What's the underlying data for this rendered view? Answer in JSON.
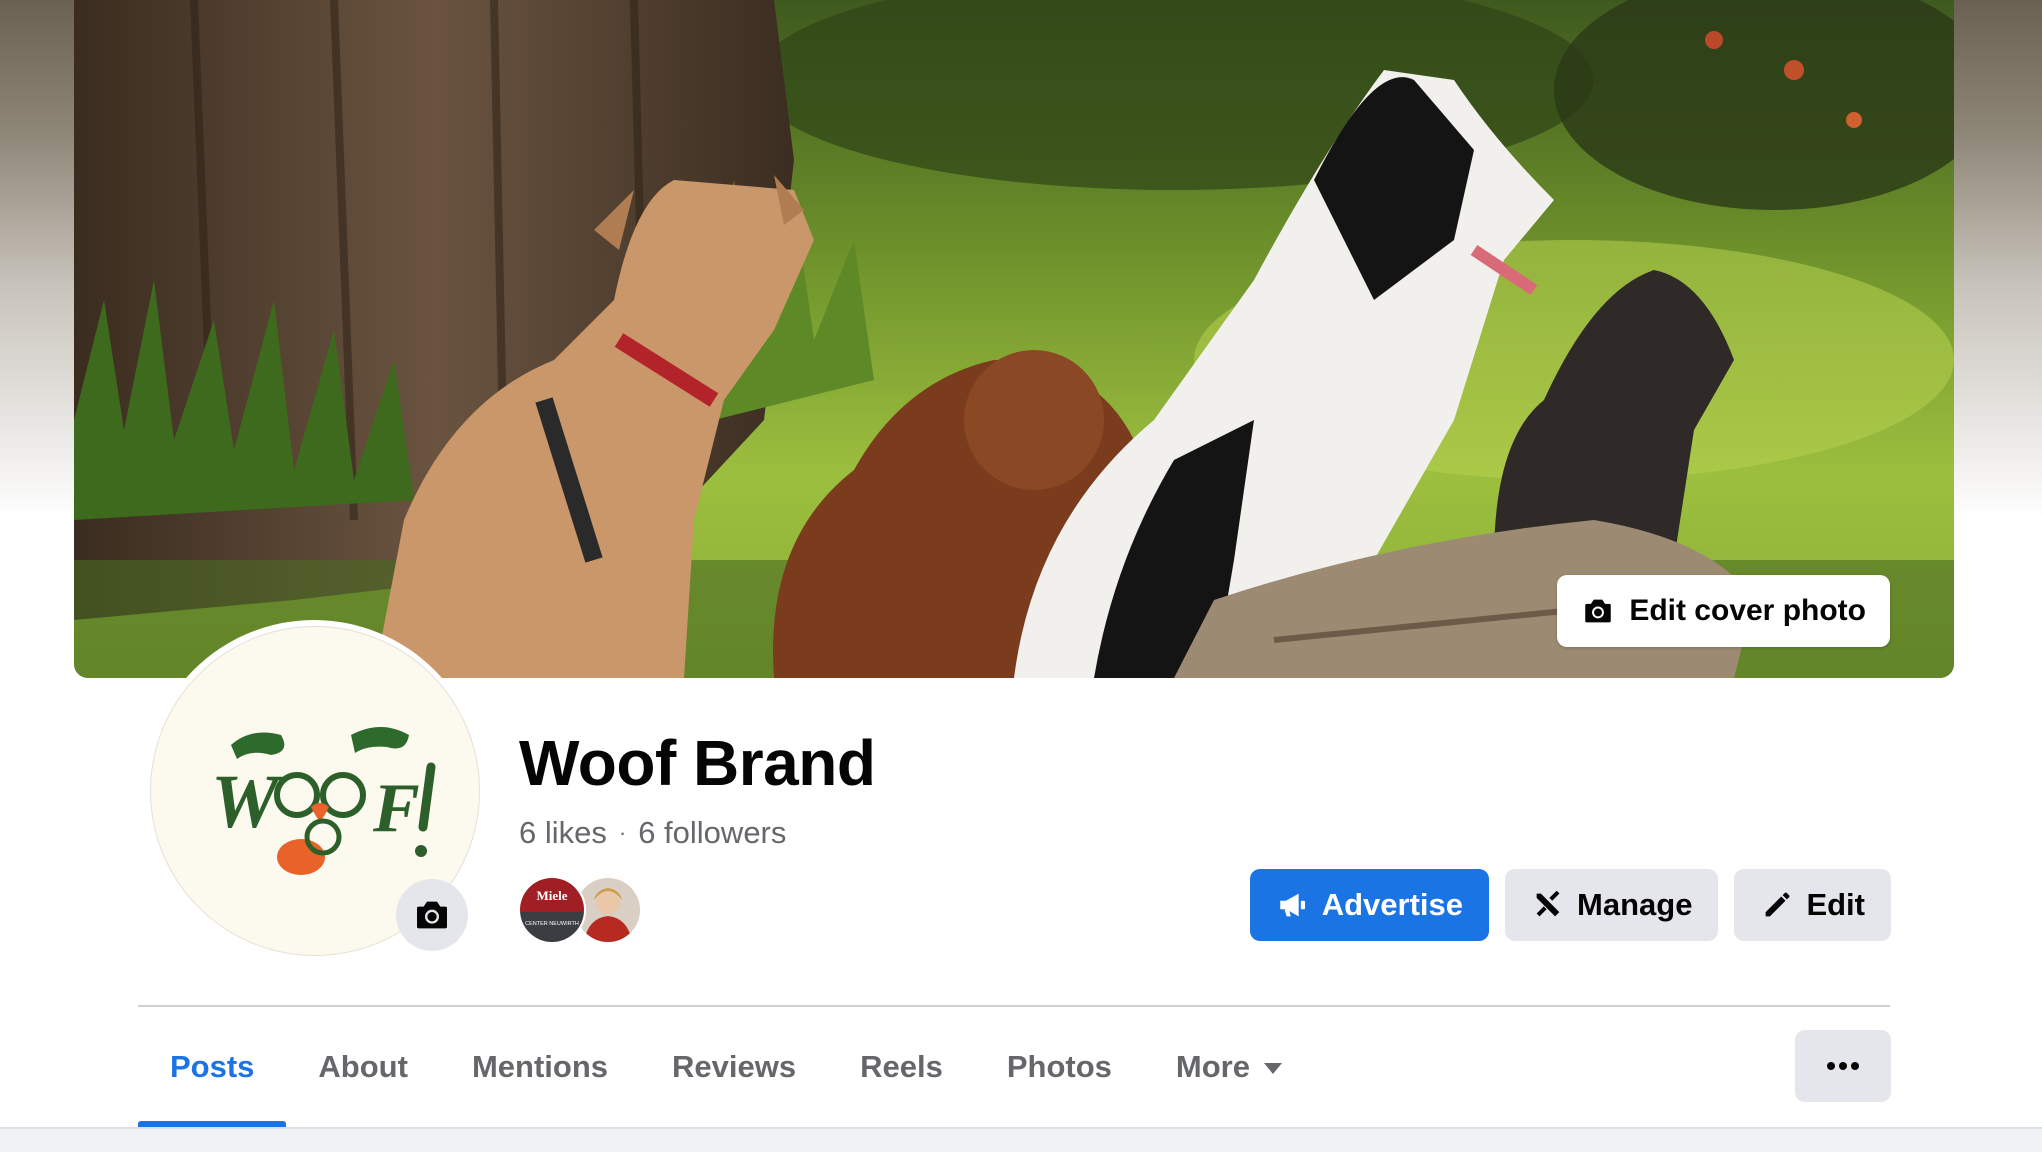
{
  "cover": {
    "edit_label": "Edit cover photo",
    "icon": "camera-icon"
  },
  "profile": {
    "name": "Woof Brand",
    "likes": "6 likes",
    "separator": "·",
    "followers": "6 followers",
    "avatar_logo_text": "WOOF!",
    "avatar_icon": "camera-icon",
    "follower_faces": [
      {
        "name": "miele-center-avatar",
        "text": "Miele",
        "subtext": "CENTER NEUWIRTH"
      },
      {
        "name": "person-avatar"
      }
    ]
  },
  "actions": {
    "advertise": "Advertise",
    "manage": "Manage",
    "edit": "Edit"
  },
  "tabs": [
    {
      "label": "Posts",
      "active": true
    },
    {
      "label": "About",
      "active": false
    },
    {
      "label": "Mentions",
      "active": false
    },
    {
      "label": "Reviews",
      "active": false
    },
    {
      "label": "Reels",
      "active": false
    },
    {
      "label": "Photos",
      "active": false
    },
    {
      "label": "More",
      "active": false
    }
  ],
  "colors": {
    "accent": "#1b74e4",
    "secondary_button": "#e4e6eb",
    "muted_text": "#65676b"
  }
}
